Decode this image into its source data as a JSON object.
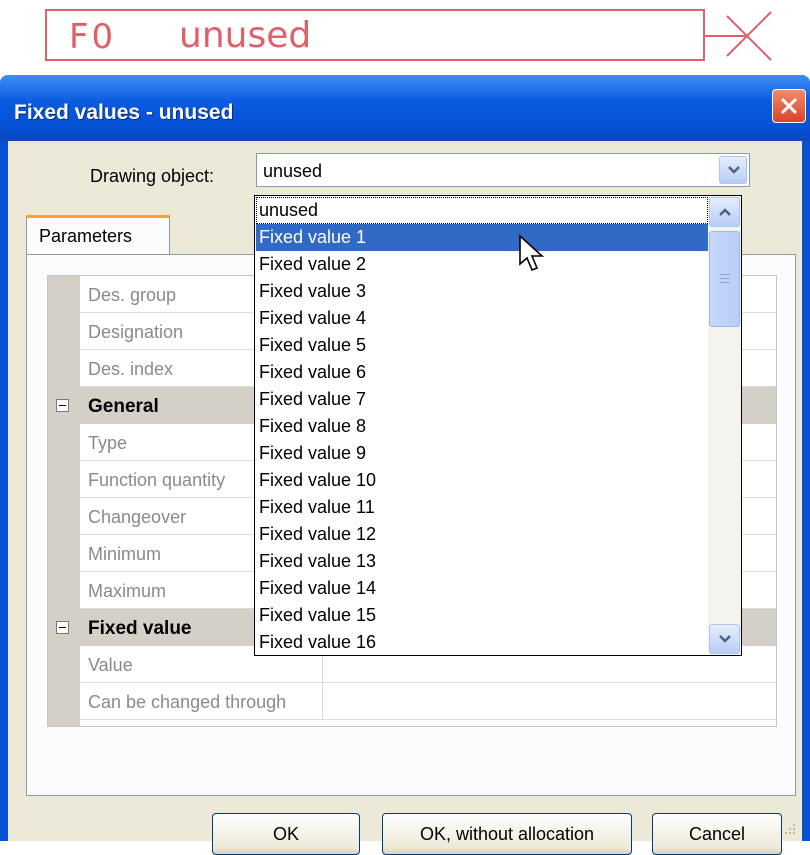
{
  "drawing_object": {
    "id_label": "F0",
    "name": "unused"
  },
  "dialog": {
    "title": "Fixed values - unused",
    "drawing_object_label": "Drawing object:",
    "drawing_object_value": "unused",
    "tab_label": "Parameters",
    "rows": [
      {
        "type": "prop",
        "name": "Des. group"
      },
      {
        "type": "prop",
        "name": "Designation"
      },
      {
        "type": "prop",
        "name": "Des. index"
      },
      {
        "type": "cat",
        "name": "General"
      },
      {
        "type": "prop",
        "name": "Type"
      },
      {
        "type": "prop",
        "name": "Function quantity"
      },
      {
        "type": "prop",
        "name": "Changeover"
      },
      {
        "type": "prop",
        "name": "Minimum"
      },
      {
        "type": "prop",
        "name": "Maximum"
      },
      {
        "type": "cat",
        "name": "Fixed value"
      },
      {
        "type": "prop",
        "name": "Value"
      },
      {
        "type": "prop",
        "name": "Can be changed through"
      }
    ],
    "buttons": {
      "ok": "OK",
      "ok_without": "OK, without allocation",
      "cancel": "Cancel"
    }
  },
  "dropdown": {
    "selected_index": 1,
    "options": [
      "unused",
      "Fixed value 1",
      "Fixed value 2",
      "Fixed value 3",
      "Fixed value 4",
      "Fixed value 5",
      "Fixed value 6",
      "Fixed value 7",
      "Fixed value 8",
      "Fixed value 9",
      "Fixed value 10",
      "Fixed value 11",
      "Fixed value 12",
      "Fixed value 13",
      "Fixed value 14",
      "Fixed value 15",
      "Fixed value 16"
    ]
  },
  "colors": {
    "accent_red": "#e0606a",
    "selection": "#316ac5",
    "titlebar": "#0a5ae0"
  }
}
